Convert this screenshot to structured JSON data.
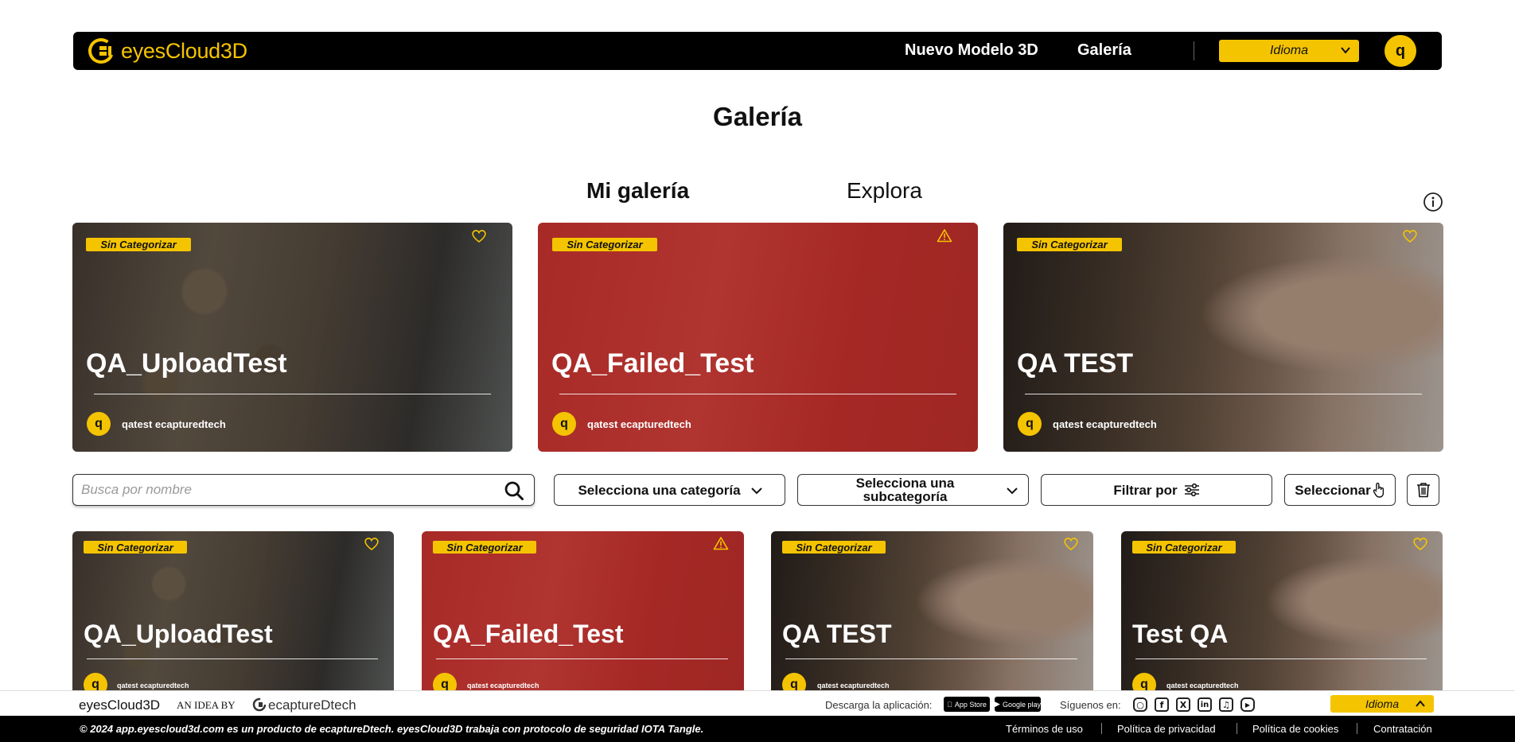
{
  "header": {
    "logo_text": "eyesCloud3D",
    "nav": [
      "Nuevo Modelo 3D",
      "Galería"
    ],
    "language_label": "Idioma",
    "user_initial": "q"
  },
  "page": {
    "title": "Galería",
    "tabs": [
      {
        "label": "Mi galería",
        "active": true
      },
      {
        "label": "Explora",
        "active": false
      }
    ]
  },
  "featured_cards": [
    {
      "category": "Sin Categorizar",
      "title": "QA_UploadTest",
      "owner": "qatest ecapturedtech",
      "owner_initial": "q",
      "status_icon": "heart-icon",
      "bg": "stone"
    },
    {
      "category": "Sin Categorizar",
      "title": "QA_Failed_Test",
      "owner": "qatest ecapturedtech",
      "owner_initial": "q",
      "status_icon": "warning-icon",
      "bg": "red"
    },
    {
      "category": "Sin Categorizar",
      "title": "QA TEST",
      "owner": "qatest ecapturedtech",
      "owner_initial": "q",
      "status_icon": "heart-icon",
      "bg": "woman"
    }
  ],
  "filters": {
    "search_placeholder": "Busca por nombre",
    "category_label": "Selecciona una categoría",
    "subcategory_label": "Selecciona una subcategoría",
    "filter_label": "Filtrar por",
    "select_label": "Seleccionar"
  },
  "gallery_cards": [
    {
      "category": "Sin Categorizar",
      "title": "QA_UploadTest",
      "owner": "qatest ecapturedtech",
      "owner_initial": "q",
      "status_icon": "heart-icon",
      "bg": "stone"
    },
    {
      "category": "Sin Categorizar",
      "title": "QA_Failed_Test",
      "owner": "qatest ecapturedtech",
      "owner_initial": "q",
      "status_icon": "warning-icon",
      "bg": "red"
    },
    {
      "category": "Sin Categorizar",
      "title": "QA TEST",
      "owner": "qatest ecapturedtech",
      "owner_initial": "q",
      "status_icon": "heart-icon",
      "bg": "woman"
    },
    {
      "category": "Sin Categorizar",
      "title": "Test QA",
      "owner": "qatest ecapturedtech",
      "owner_initial": "q",
      "status_icon": "heart-icon",
      "bg": "woman"
    }
  ],
  "footer": {
    "brand": "eyesCloud3D",
    "idea_by": "AN IDEA BY",
    "company": "ecaptureDtech",
    "download_label": "Descarga la aplicación:",
    "app_store": "App Store",
    "google_play": "Google play",
    "follow_label": "Síguenos en:",
    "social": [
      "instagram-icon",
      "facebook-icon",
      "x-icon",
      "linkedin-icon",
      "tiktok-icon",
      "youtube-icon"
    ],
    "language_label": "Idioma",
    "copyright": "© 2024 app.eyescloud3d.com es un producto de ecaptureDtech. eyesCloud3D trabaja con protocolo de seguridad IOTA Tangle.",
    "links": [
      "Términos de uso",
      "Política de privacidad",
      "Política de cookies",
      "Contratación"
    ]
  },
  "colors": {
    "accent": "#f5c400",
    "failed": "#a82a26",
    "navbar": "#000000"
  }
}
